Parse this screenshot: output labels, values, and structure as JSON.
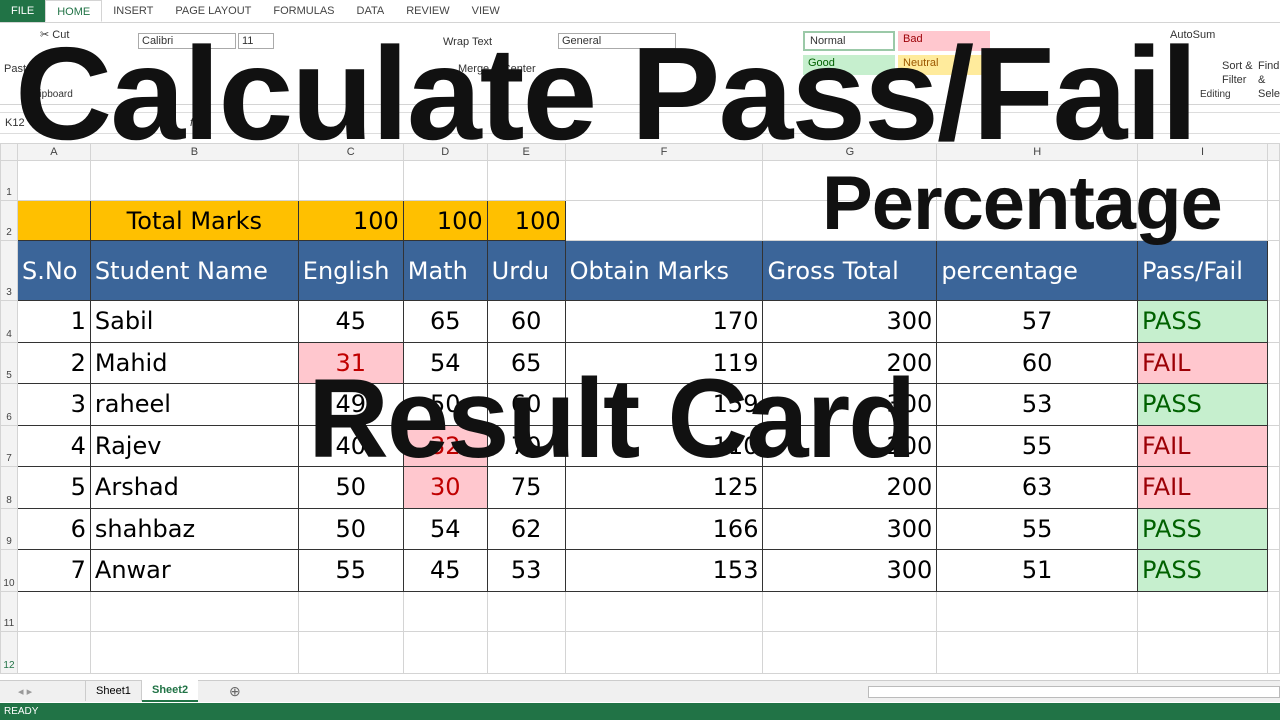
{
  "ribbon": {
    "tabs": [
      "FILE",
      "HOME",
      "INSERT",
      "PAGE LAYOUT",
      "FORMULAS",
      "DATA",
      "REVIEW",
      "VIEW"
    ],
    "cut": "Cut",
    "paste": "Paste",
    "clipboard": "Clipboard",
    "font": "Calibri",
    "size": "11",
    "wrap": "Wrap Text",
    "merge": "Merge & Center",
    "number_format": "General",
    "styles": {
      "normal": "Normal",
      "bad": "Bad",
      "good": "Good",
      "neutral": "Neutral"
    },
    "autosum": "AutoSum",
    "sort": "Sort & Filter",
    "find": "Find & Select",
    "editing": "Editing"
  },
  "formula": {
    "name_box": "K12",
    "fx": "fx"
  },
  "columns": [
    "A",
    "B",
    "C",
    "D",
    "E",
    "F",
    "G",
    "H",
    "I"
  ],
  "row_numbers": [
    "1",
    "2",
    "3",
    "4",
    "5",
    "6",
    "7",
    "8",
    "9",
    "10",
    "11",
    "12"
  ],
  "total": {
    "label": "Total Marks",
    "english": "100",
    "math": "100",
    "urdu": "100"
  },
  "headers": [
    "S.No",
    "Student Name",
    "English",
    "Math",
    "Urdu",
    "Obtain Marks",
    "Gross Total",
    "percentage",
    "Pass/Fail"
  ],
  "rows": [
    [
      "1",
      "Sabil",
      "45",
      "65",
      "60",
      "170",
      "300",
      "57",
      "PASS"
    ],
    [
      "2",
      "Mahid",
      "31",
      "54",
      "65",
      "119",
      "200",
      "60",
      "FAIL"
    ],
    [
      "3",
      "raheel",
      "49",
      "50",
      "60",
      "159",
      "300",
      "53",
      "PASS"
    ],
    [
      "4",
      "Rajev",
      "40",
      "32",
      "70",
      "110",
      "200",
      "55",
      "FAIL"
    ],
    [
      "5",
      "Arshad",
      "50",
      "30",
      "75",
      "125",
      "200",
      "63",
      "FAIL"
    ],
    [
      "6",
      "shahbaz",
      "50",
      "54",
      "62",
      "166",
      "300",
      "55",
      "PASS"
    ],
    [
      "7",
      "Anwar",
      "55",
      "45",
      "53",
      "153",
      "300",
      "51",
      "PASS"
    ]
  ],
  "fail_highlight": [
    [
      1,
      "english"
    ],
    [
      3,
      "math"
    ],
    [
      4,
      "math"
    ]
  ],
  "sheets": [
    "Sheet1",
    "Sheet2"
  ],
  "active_sheet": "Sheet2",
  "status": "READY",
  "overlay": {
    "title": "Calculate Pass/Fail",
    "subtitle": "Percentage",
    "card": "Result Card"
  },
  "colors": {
    "header": "#3b6599",
    "gold": "#ffc000",
    "pass": "#c6efce",
    "fail": "#ffc7ce",
    "excel_green": "#217346"
  }
}
